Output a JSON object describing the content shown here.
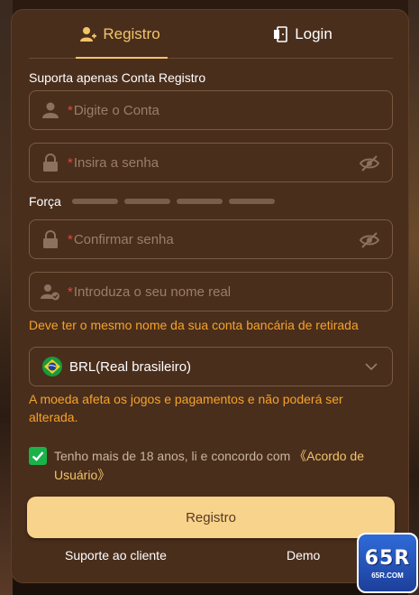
{
  "tabs": [
    {
      "label": "Registro",
      "icon": "user-add-icon",
      "active": true
    },
    {
      "label": "Login",
      "icon": "login-door-icon",
      "active": false
    }
  ],
  "form": {
    "account_note": "Suporta apenas Conta Registro",
    "account": {
      "required_mark": "*",
      "placeholder": "Digite o Conta",
      "icon": "user-icon"
    },
    "password": {
      "required_mark": "*",
      "placeholder": "Insira a senha",
      "icon": "lock-icon"
    },
    "strength_label": "Força",
    "strength_level": 0,
    "confirm_password": {
      "required_mark": "*",
      "placeholder": "Confirmar senha",
      "icon": "lock-icon"
    },
    "real_name": {
      "required_mark": "*",
      "placeholder": "Introduza o seu nome real",
      "icon": "user-verified-icon"
    },
    "real_name_hint": "Deve ter o mesmo nome da sua conta bancária de retirada",
    "currency": {
      "value": "BRL(Real brasileiro)",
      "flag": "brazil-flag-icon"
    },
    "currency_hint": "A moeda afeta os jogos e pagamentos e não poderá ser alterada.",
    "agree_checked": true,
    "agree_text": "Tenho mais de 18 anos, li e concordo com",
    "agree_link": "《Acordo de Usuário》",
    "submit_label": "Registro"
  },
  "footer": {
    "support_label": "Suporte ao cliente",
    "demo_label": "Demo"
  },
  "badge": {
    "logo": "65R",
    "domain": "65R.COM"
  },
  "colors": {
    "panel": "#4a2e1c",
    "accent": "#f2c46a",
    "hint": "#f5a32a",
    "required": "#e0483d",
    "button": "#f8d38c",
    "checkbox": "#19b34a"
  }
}
